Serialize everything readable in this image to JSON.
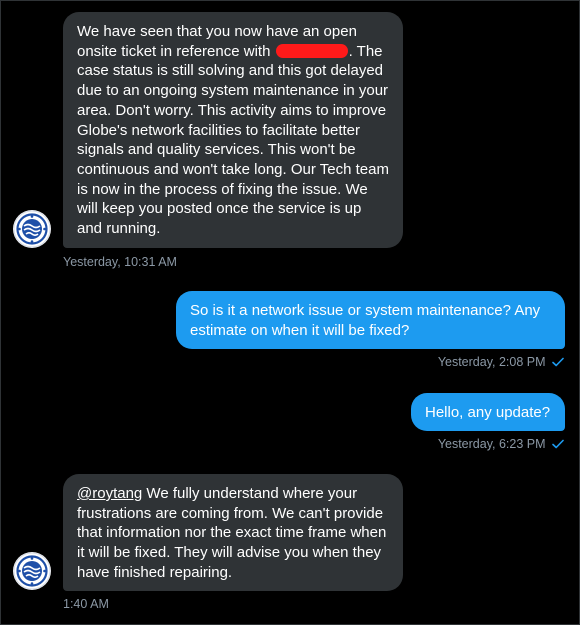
{
  "messages": [
    {
      "side": "incoming",
      "text_before_redaction": "We have seen that you now have an open onsite ticket in reference with ",
      "text_after_redaction": ". The case status is still solving and this got delayed due to an ongoing system maintenance in your area. Don't worry. This activity aims to improve Globe's network facilities to facilitate better signals and quality services. This won't be continuous and won't take long. Our Tech team is now in the process of fixing the issue. We will keep you posted once the service is up and running.",
      "timestamp": "Yesterday, 10:31 AM"
    },
    {
      "side": "outgoing",
      "text": "So is it a network issue or system maintenance? Any estimate on when it will be fixed?",
      "timestamp": "Yesterday, 2:08 PM"
    },
    {
      "side": "outgoing",
      "text": "Hello, any update?",
      "timestamp": "Yesterday, 6:23 PM"
    },
    {
      "side": "incoming",
      "mention": "@roytang",
      "text": " We fully understand where your frustrations are coming from. We can't provide that information nor the exact time frame when it will be fixed. They will advise you when they have finished repairing.",
      "timestamp": "1:40 AM"
    }
  ],
  "colors": {
    "background": "#000000",
    "incoming_bubble": "#2f3336",
    "outgoing_bubble": "#1d9bf0",
    "timestamp": "#8b98a5",
    "read_check": "#1d9bf0",
    "redaction": "#ff1a1a",
    "avatar_blue": "#1e4fa8"
  },
  "icons": {
    "avatar": "globe-logo-icon",
    "read_receipt": "double-check-icon"
  }
}
